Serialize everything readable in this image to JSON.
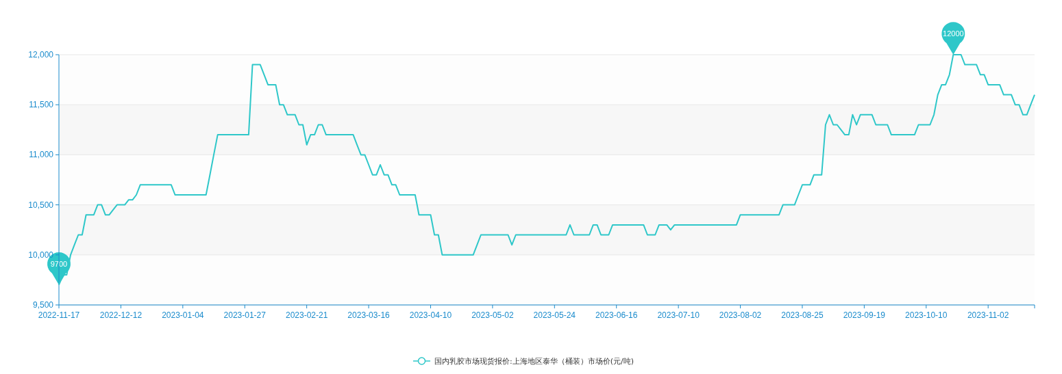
{
  "chart": {
    "chart_data": {
      "type": "line",
      "categories": [
        "2022-11-17",
        null,
        null,
        null,
        null,
        null,
        null,
        null,
        null,
        null,
        null,
        null,
        null,
        null,
        null,
        null,
        "2022-12-12",
        null,
        null,
        null,
        null,
        null,
        null,
        null,
        null,
        null,
        null,
        null,
        null,
        null,
        null,
        null,
        "2023-01-04",
        null,
        null,
        null,
        null,
        null,
        null,
        null,
        null,
        null,
        null,
        null,
        null,
        null,
        null,
        null,
        "2023-01-27",
        null,
        null,
        null,
        null,
        null,
        null,
        null,
        null,
        null,
        null,
        null,
        null,
        null,
        null,
        null,
        "2023-02-21",
        null,
        null,
        null,
        null,
        null,
        null,
        null,
        null,
        null,
        null,
        null,
        null,
        null,
        null,
        null,
        "2023-03-16",
        null,
        null,
        null,
        null,
        null,
        null,
        null,
        null,
        null,
        null,
        null,
        null,
        null,
        null,
        null,
        "2023-04-10",
        null,
        null,
        null,
        null,
        null,
        null,
        null,
        null,
        null,
        null,
        null,
        null,
        null,
        null,
        null,
        "2023-05-02",
        null,
        null,
        null,
        null,
        null,
        null,
        null,
        null,
        null,
        null,
        null,
        null,
        null,
        null,
        null,
        "2023-05-24",
        null,
        null,
        null,
        null,
        null,
        null,
        null,
        null,
        null,
        null,
        null,
        null,
        null,
        null,
        null,
        "2023-06-16",
        null,
        null,
        null,
        null,
        null,
        null,
        null,
        null,
        null,
        null,
        null,
        null,
        null,
        null,
        null,
        "2023-07-10",
        null,
        null,
        null,
        null,
        null,
        null,
        null,
        null,
        null,
        null,
        null,
        null,
        null,
        null,
        null,
        "2023-08-02",
        null,
        null,
        null,
        null,
        null,
        null,
        null,
        null,
        null,
        null,
        null,
        null,
        null,
        null,
        null,
        "2023-08-25",
        null,
        null,
        null,
        null,
        null,
        null,
        null,
        null,
        null,
        null,
        null,
        null,
        null,
        null,
        null,
        "2023-09-19",
        null,
        null,
        null,
        null,
        null,
        null,
        null,
        null,
        null,
        null,
        null,
        null,
        null,
        null,
        null,
        "2023-10-10",
        null,
        null,
        null,
        null,
        null,
        null,
        null,
        null,
        null,
        null,
        null,
        null,
        null,
        null,
        null,
        "2023-11-02",
        null,
        null,
        null,
        null,
        null,
        null,
        null,
        null,
        null,
        null,
        null,
        null
      ],
      "series": [
        {
          "name": "国内乳胶市场现货报价:上海地区泰华（桶装）市场价(元/吨)",
          "color": "#2ec7c9",
          "values": [
            9700,
            9800,
            9800,
            10000,
            10100,
            10200,
            10200,
            10400,
            10400,
            10400,
            10500,
            10500,
            10400,
            10400,
            10450,
            10500,
            10500,
            10500,
            10550,
            10550,
            10600,
            10700,
            10700,
            10700,
            10700,
            10700,
            10700,
            10700,
            10700,
            10700,
            10600,
            10600,
            10600,
            10600,
            10600,
            10600,
            10600,
            10600,
            10600,
            10800,
            11000,
            11200,
            11200,
            11200,
            11200,
            11200,
            11200,
            11200,
            11200,
            11200,
            11900,
            11900,
            11900,
            11800,
            11700,
            11700,
            11700,
            11500,
            11500,
            11400,
            11400,
            11400,
            11300,
            11300,
            11100,
            11200,
            11200,
            11300,
            11300,
            11200,
            11200,
            11200,
            11200,
            11200,
            11200,
            11200,
            11200,
            11100,
            11000,
            11000,
            10900,
            10800,
            10800,
            10900,
            10800,
            10800,
            10700,
            10700,
            10600,
            10600,
            10600,
            10600,
            10600,
            10400,
            10400,
            10400,
            10400,
            10200,
            10200,
            10000,
            10000,
            10000,
            10000,
            10000,
            10000,
            10000,
            10000,
            10000,
            10100,
            10200,
            10200,
            10200,
            10200,
            10200,
            10200,
            10200,
            10200,
            10100,
            10200,
            10200,
            10200,
            10200,
            10200,
            10200,
            10200,
            10200,
            10200,
            10200,
            10200,
            10200,
            10200,
            10200,
            10300,
            10200,
            10200,
            10200,
            10200,
            10200,
            10300,
            10300,
            10200,
            10200,
            10200,
            10300,
            10300,
            10300,
            10300,
            10300,
            10300,
            10300,
            10300,
            10300,
            10200,
            10200,
            10200,
            10300,
            10300,
            10300,
            10250,
            10300,
            10300,
            10300,
            10300,
            10300,
            10300,
            10300,
            10300,
            10300,
            10300,
            10300,
            10300,
            10300,
            10300,
            10300,
            10300,
            10300,
            10400,
            10400,
            10400,
            10400,
            10400,
            10400,
            10400,
            10400,
            10400,
            10400,
            10400,
            10500,
            10500,
            10500,
            10500,
            10600,
            10700,
            10700,
            10700,
            10800,
            10800,
            10800,
            11300,
            11400,
            11300,
            11300,
            11250,
            11200,
            11200,
            11400,
            11300,
            11400,
            11400,
            11400,
            11400,
            11300,
            11300,
            11300,
            11300,
            11200,
            11200,
            11200,
            11200,
            11200,
            11200,
            11200,
            11300,
            11300,
            11300,
            11300,
            11400,
            11600,
            11700,
            11700,
            11800,
            12000,
            12000,
            12000,
            11900,
            11900,
            11900,
            11900,
            11800,
            11800,
            11700,
            11700,
            11700,
            11700,
            11600,
            11600,
            11600,
            11500,
            11500,
            11400,
            11400,
            11500,
            11600
          ]
        }
      ],
      "ylim": [
        9500,
        12000
      ],
      "yticks": [
        {
          "value": 9500,
          "label": "9,500"
        },
        {
          "value": 10000,
          "label": "10,000"
        },
        {
          "value": 10500,
          "label": "10,500"
        },
        {
          "value": 11000,
          "label": "11,000"
        },
        {
          "value": 11500,
          "label": "11,500"
        },
        {
          "value": 12000,
          "label": "12,000"
        }
      ],
      "grid": true,
      "annotations": [
        {
          "y": 12000,
          "text": "12000"
        },
        {
          "y": 9700,
          "text": "9700"
        }
      ]
    }
  }
}
